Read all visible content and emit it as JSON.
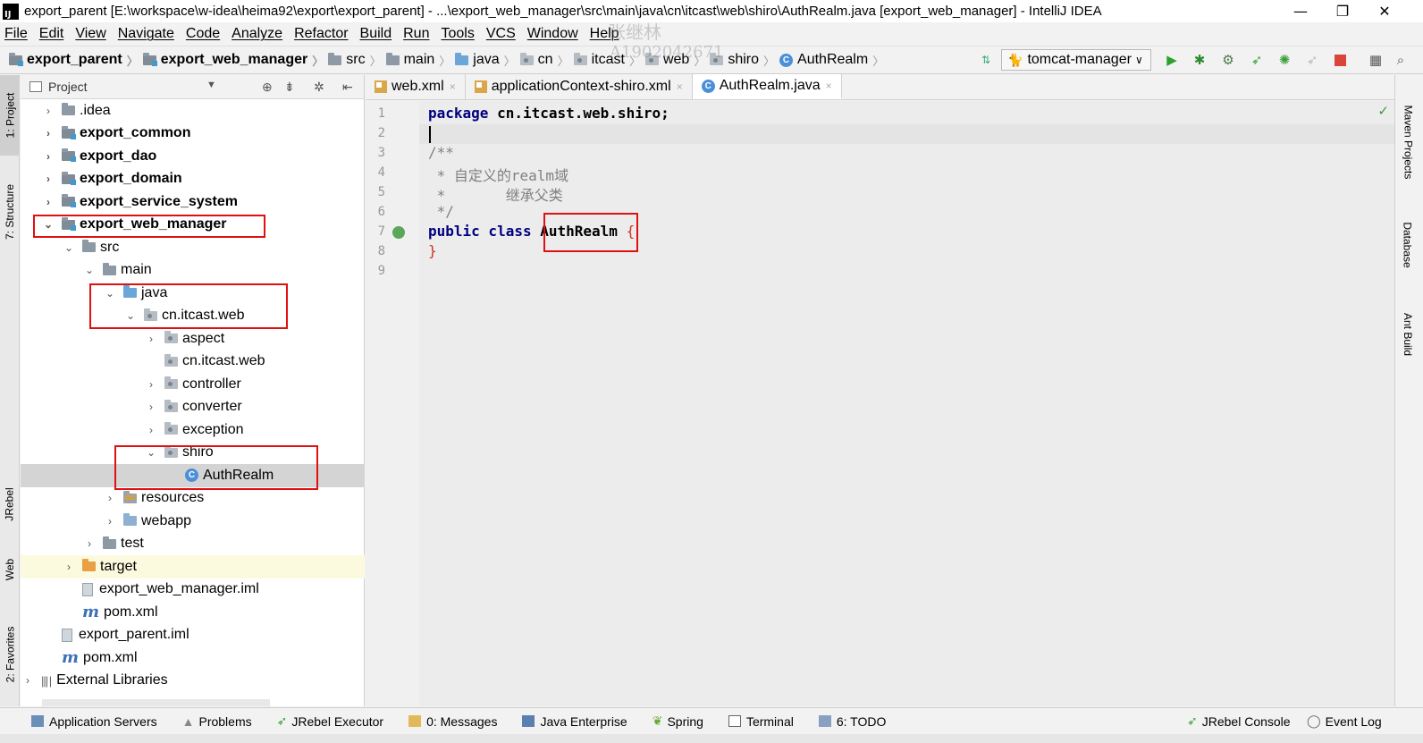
{
  "window": {
    "logo": "IJ",
    "title": "export_parent [E:\\workspace\\w-idea\\heima92\\export\\export_parent] - ...\\export_web_manager\\src\\main\\java\\cn\\itcast\\web\\shiro\\AuthRealm.java [export_web_manager] - IntelliJ IDEA",
    "minimize": "—",
    "restore": "❐",
    "close": "✕"
  },
  "menu": [
    "File",
    "Edit",
    "View",
    "Navigate",
    "Code",
    "Analyze",
    "Refactor",
    "Build",
    "Run",
    "Tools",
    "VCS",
    "Window",
    "Help"
  ],
  "breadcrumbs": [
    "export_parent",
    "export_web_manager",
    "src",
    "main",
    "java",
    "cn",
    "itcast",
    "web",
    "shiro",
    "AuthRealm"
  ],
  "run_config": {
    "label": "tomcat-manager"
  },
  "project_panel": {
    "title": "Project",
    "tree": [
      {
        "label": ".idea",
        "arrow": "›",
        "icon": "folder"
      },
      {
        "label": "export_common",
        "arrow": "›",
        "icon": "module"
      },
      {
        "label": "export_dao",
        "arrow": "›",
        "icon": "module"
      },
      {
        "label": "export_domain",
        "arrow": "›",
        "icon": "module"
      },
      {
        "label": "export_service_system",
        "arrow": "›",
        "icon": "module"
      },
      {
        "label": "export_web_manager",
        "arrow": "⌄",
        "icon": "module"
      },
      {
        "label": "src",
        "arrow": "⌄",
        "icon": "folder"
      },
      {
        "label": "main",
        "arrow": "⌄",
        "icon": "folder"
      },
      {
        "label": "java",
        "arrow": "⌄",
        "icon": "source-folder"
      },
      {
        "label": "cn.itcast.web",
        "arrow": "⌄",
        "icon": "package"
      },
      {
        "label": "aspect",
        "arrow": "›",
        "icon": "package"
      },
      {
        "label": "cn.itcast.web",
        "arrow": "",
        "icon": "package"
      },
      {
        "label": "controller",
        "arrow": "›",
        "icon": "package"
      },
      {
        "label": "converter",
        "arrow": "›",
        "icon": "package"
      },
      {
        "label": "exception",
        "arrow": "›",
        "icon": "package"
      },
      {
        "label": "shiro",
        "arrow": "⌄",
        "icon": "package"
      },
      {
        "label": "AuthRealm",
        "arrow": "",
        "icon": "class"
      },
      {
        "label": "resources",
        "arrow": "›",
        "icon": "resources"
      },
      {
        "label": "webapp",
        "arrow": "›",
        "icon": "web-folder"
      },
      {
        "label": "test",
        "arrow": "›",
        "icon": "folder"
      },
      {
        "label": "target",
        "arrow": "›",
        "icon": "excluded-folder"
      },
      {
        "label": "export_web_manager.iml",
        "arrow": "",
        "icon": "iml-file"
      },
      {
        "label": "pom.xml",
        "arrow": "",
        "icon": "maven"
      },
      {
        "label": "export_parent.iml",
        "arrow": "",
        "icon": "iml-file"
      },
      {
        "label": "pom.xml",
        "arrow": "",
        "icon": "maven"
      },
      {
        "label": "External Libraries",
        "arrow": "›",
        "icon": "libraries"
      }
    ]
  },
  "editor_tabs": [
    {
      "label": "web.xml",
      "close": "×"
    },
    {
      "label": "applicationContext-shiro.xml",
      "close": "×"
    },
    {
      "label": "AuthRealm.java",
      "close": "×"
    }
  ],
  "code": {
    "line_numbers": [
      "1",
      "2",
      "3",
      "4",
      "5",
      "6",
      "7",
      "8",
      "9"
    ],
    "l1_kw": "package",
    "l1_pkg": " cn.itcast.web.shiro;",
    "l3": "/**",
    "l4": " * 自定义的realm域",
    "l5": " *       继承父类",
    "l6": " */",
    "l7_kw": "public class ",
    "l7_cls": "AuthRealm",
    "l7_brace": " {",
    "l8": "}"
  },
  "left_tabs": [
    "1: Project",
    "7: Structure",
    "JRebel",
    "Web",
    "2: Favorites"
  ],
  "right_tabs": [
    "Maven Projects",
    "Database",
    "Ant Build"
  ],
  "bottom_tools": [
    "Application Servers",
    "Problems",
    "JRebel Executor",
    "0: Messages",
    "Java Enterprise",
    "Spring",
    "Terminal",
    "6: TODO"
  ],
  "bottom_right_tools": [
    "JRebel Console",
    "Event Log"
  ],
  "watermark": {
    "name": "张继林",
    "id": "A1902042671"
  },
  "colors": {
    "red_highlight": "#e01010",
    "keyword": "#000080",
    "selection": "#d4d4d4"
  }
}
